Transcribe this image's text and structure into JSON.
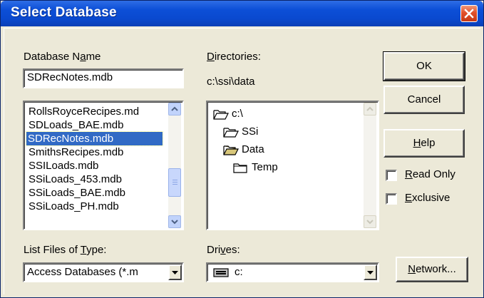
{
  "window": {
    "title": "Select Database"
  },
  "database_name": {
    "label_before": "Database N",
    "label_access": "a",
    "label_after": "me",
    "value": "SDRecNotes.mdb",
    "files": [
      "RollsRoyceRecipes.md",
      "SDLoads_BAE.mdb",
      "SDRecNotes.mdb",
      "SmithsRecipes.mdb",
      "SSILoads.mdb",
      "SSiLoads_453.mdb",
      "SSiLoads_BAE.mdb",
      "SSiLoads_PH.mdb"
    ],
    "selected_index": 2
  },
  "directories": {
    "label_access": "D",
    "label_after": "irectories:",
    "current_path": "c:\\ssi\\data",
    "tree": [
      {
        "label": "c:\\",
        "icon": "open-folder-icon"
      },
      {
        "label": "SSi",
        "icon": "open-folder-icon"
      },
      {
        "label": "Data",
        "icon": "open-folder-selected-icon"
      },
      {
        "label": "Temp",
        "icon": "closed-folder-icon"
      }
    ]
  },
  "file_type": {
    "label_before": "List Files of ",
    "label_access": "T",
    "label_after": "ype:",
    "value": "Access Databases (*.m"
  },
  "drives": {
    "label_before": "Dri",
    "label_access": "v",
    "label_after": "es:",
    "value": "c:",
    "icon": "drive-icon"
  },
  "buttons": {
    "ok": "OK",
    "cancel": "Cancel",
    "help_access": "H",
    "help_after": "elp",
    "network_access": "N",
    "network_after": "etwork..."
  },
  "options": {
    "read_only_access": "R",
    "read_only_after": "ead Only",
    "read_only_checked": false,
    "exclusive_access": "E",
    "exclusive_after": "xclusive",
    "exclusive_checked": false
  },
  "colors": {
    "title_bar": "#0A49CF",
    "selection": "#316AC5",
    "dialog_face": "#ECE9D8",
    "close_button": "#E2502A"
  }
}
